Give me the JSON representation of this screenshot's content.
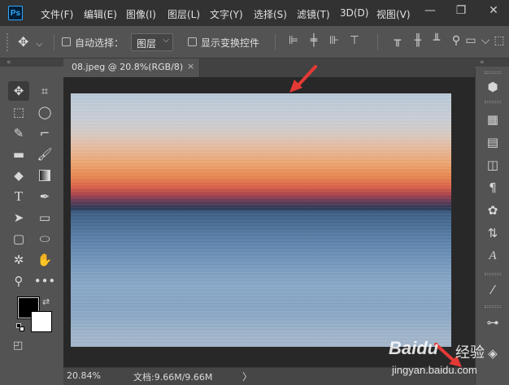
{
  "app": {
    "logo": "Ps"
  },
  "menu": {
    "items": [
      "文件(F)",
      "编辑(E)",
      "图像(I)",
      "图层(L)",
      "文字(Y)",
      "选择(S)",
      "滤镜(T)",
      "3D(D)",
      "视图(V)"
    ]
  },
  "window_controls": {
    "minimize": "—",
    "restore": "❐",
    "close": "✕"
  },
  "options": {
    "auto_select_label": "自动选择：",
    "auto_select_value": "图层",
    "show_transform_label": "显示变换控件"
  },
  "document": {
    "tab_title": "08.jpeg @ 20.8%(RGB/8)",
    "tab_close": "×"
  },
  "status": {
    "zoom": "20.84%",
    "doc_info": "文档:9.66M/9.66M",
    "arrow": "〉"
  },
  "colors": {
    "foreground": "#000000",
    "background": "#ffffff",
    "annotation_arrow": "#e53935"
  },
  "watermark": {
    "brand": "Baidu",
    "suffix": "经验",
    "url": "jingyan.baidu.com"
  },
  "strip": {
    "collapse": "«"
  }
}
